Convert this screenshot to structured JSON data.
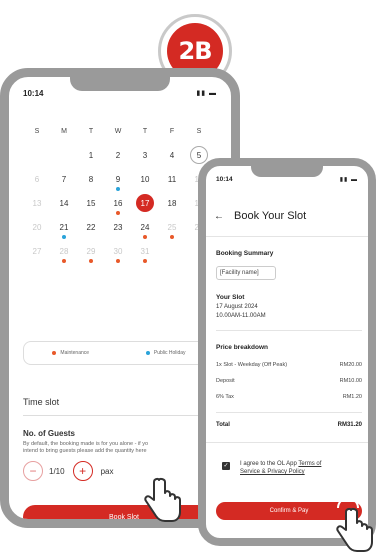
{
  "badge": {
    "label": "2B"
  },
  "phone1": {
    "time": "10:14",
    "status_icons": "▮▮ ▬",
    "weekdays": [
      "S",
      "M",
      "T",
      "W",
      "T",
      "F",
      "S"
    ],
    "weeks": [
      [
        {
          "d": ""
        },
        {
          "d": ""
        },
        {
          "d": "1"
        },
        {
          "d": "2"
        },
        {
          "d": "3"
        },
        {
          "d": "4"
        },
        {
          "d": "5",
          "circle": true
        }
      ],
      [
        {
          "d": "6",
          "muted": true
        },
        {
          "d": "7"
        },
        {
          "d": "8"
        },
        {
          "d": "9",
          "dot": "blue"
        },
        {
          "d": "10"
        },
        {
          "d": "11"
        },
        {
          "d": "12",
          "muted": true
        }
      ],
      [
        {
          "d": "13",
          "muted": true
        },
        {
          "d": "14"
        },
        {
          "d": "15"
        },
        {
          "d": "16",
          "dot": "red"
        },
        {
          "d": "17",
          "selected": true
        },
        {
          "d": "18"
        },
        {
          "d": "19",
          "muted": true
        }
      ],
      [
        {
          "d": "20",
          "muted": true
        },
        {
          "d": "21",
          "dot": "blue"
        },
        {
          "d": "22"
        },
        {
          "d": "23"
        },
        {
          "d": "24",
          "dot": "red"
        },
        {
          "d": "25",
          "muted": true,
          "dot": "red"
        },
        {
          "d": "26",
          "muted": true
        }
      ],
      [
        {
          "d": "27",
          "muted": true
        },
        {
          "d": "28",
          "muted": true,
          "dot": "red"
        },
        {
          "d": "29",
          "muted": true,
          "dot": "red"
        },
        {
          "d": "30",
          "muted": true,
          "dot": "red"
        },
        {
          "d": "31",
          "muted": true,
          "dot": "red"
        },
        {
          "d": ""
        },
        {
          "d": ""
        }
      ]
    ],
    "legend": {
      "maintenance": "Maintenance",
      "public_holiday": "Public Holiday"
    },
    "colors": {
      "accent": "#d42a23",
      "maintenance": "#e8592a",
      "holiday": "#2aa3d9"
    },
    "time_slot": {
      "label": "Time slot",
      "chevron": "⌄"
    },
    "guests": {
      "title": "No. of Guests",
      "desc_line1": "By default, the booking made is for you alone - if yo",
      "desc_line2": "intend to bring guests please add the quantity here",
      "minus": "−",
      "value": "1/10",
      "plus": "+",
      "unit": "pax"
    },
    "book_button": "Book Slot"
  },
  "phone2": {
    "time": "10:14",
    "status_icons": "▮▮ ▬",
    "back": "←",
    "title": "Book Your Slot",
    "summary_label": "Booking Summary",
    "facility": "[Facility name]",
    "slot_label": "Your Slot",
    "slot_date": "17 August 2024",
    "slot_time": "10.00AM-11.00AM",
    "price_label": "Price breakdown",
    "prices": [
      {
        "name": "1x Slot - Weekday (Off Peak)",
        "value": "RM20.00"
      },
      {
        "name": "Deposit",
        "value": "RM10.00"
      },
      {
        "name": "6% Tax",
        "value": "RM1.20"
      }
    ],
    "total_label": "Total",
    "total_value": "RM31.20",
    "agree_prefix": "I agree to the OL App ",
    "agree_terms": "Terms of",
    "agree_policy": "Service & Privacy Policy",
    "confirm_button": "Confirm & Pay"
  }
}
